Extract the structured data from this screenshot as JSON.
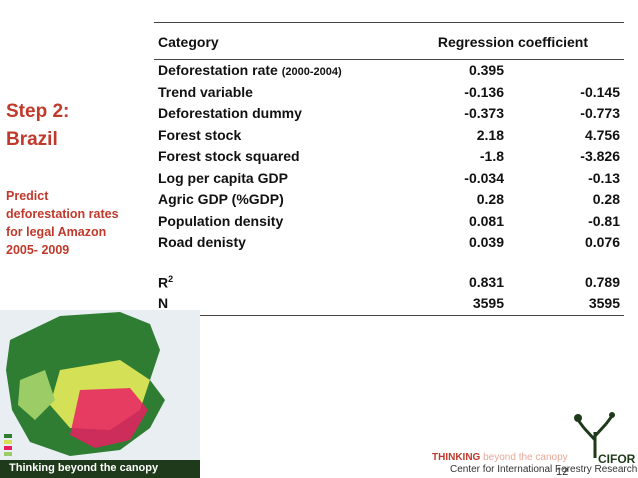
{
  "sidebar": {
    "step_title_line1": "Step 2:",
    "step_title_line2": "Brazil",
    "subtitle_lines": [
      "Predict",
      "deforestation rates",
      "for legal Amazon",
      "2005- 2009"
    ]
  },
  "table": {
    "header_category": "Category",
    "header_coef": "Regression coefficient",
    "rows": [
      {
        "label": "Deforestation rate ",
        "label_small": "(2000-2004)",
        "v1": "0.395",
        "v2": ""
      },
      {
        "label": "Trend variable",
        "v1": "-0.136",
        "v2": "-0.145"
      },
      {
        "label": "Deforestation dummy",
        "v1": "-0.373",
        "v2": "-0.773"
      },
      {
        "label": "Forest stock",
        "v1": "2.18",
        "v2": "4.756"
      },
      {
        "label": "Forest stock squared",
        "v1": "-1.8",
        "v2": "-3.826"
      },
      {
        "label": "Log per capita GDP",
        "v1": "-0.034",
        "v2": "-0.13"
      },
      {
        "label": "Agric GDP (%GDP)",
        "v1": "0.28",
        "v2": "0.28"
      },
      {
        "label": "Population density",
        "v1": "0.081",
        "v2": "-0.81"
      },
      {
        "label": "Road denisty",
        "v1": "0.039",
        "v2": "0.076"
      }
    ],
    "r2_label": "R",
    "r2_sup": "2",
    "r2_v1": "0.831",
    "r2_v2": "0.789",
    "n_label": "N",
    "n_v1": "3595",
    "n_v2": "3595"
  },
  "footer": {
    "left_text": "Thinking beyond the canopy",
    "tagline_bold": "THINKING",
    "tagline_rest": " beyond the canopy",
    "org_name": "Center for International Forestry Research",
    "org_short": "CIFOR",
    "page_number": "12"
  },
  "colors": {
    "accent": "#c0392b",
    "forest": "#1f3a1a"
  }
}
